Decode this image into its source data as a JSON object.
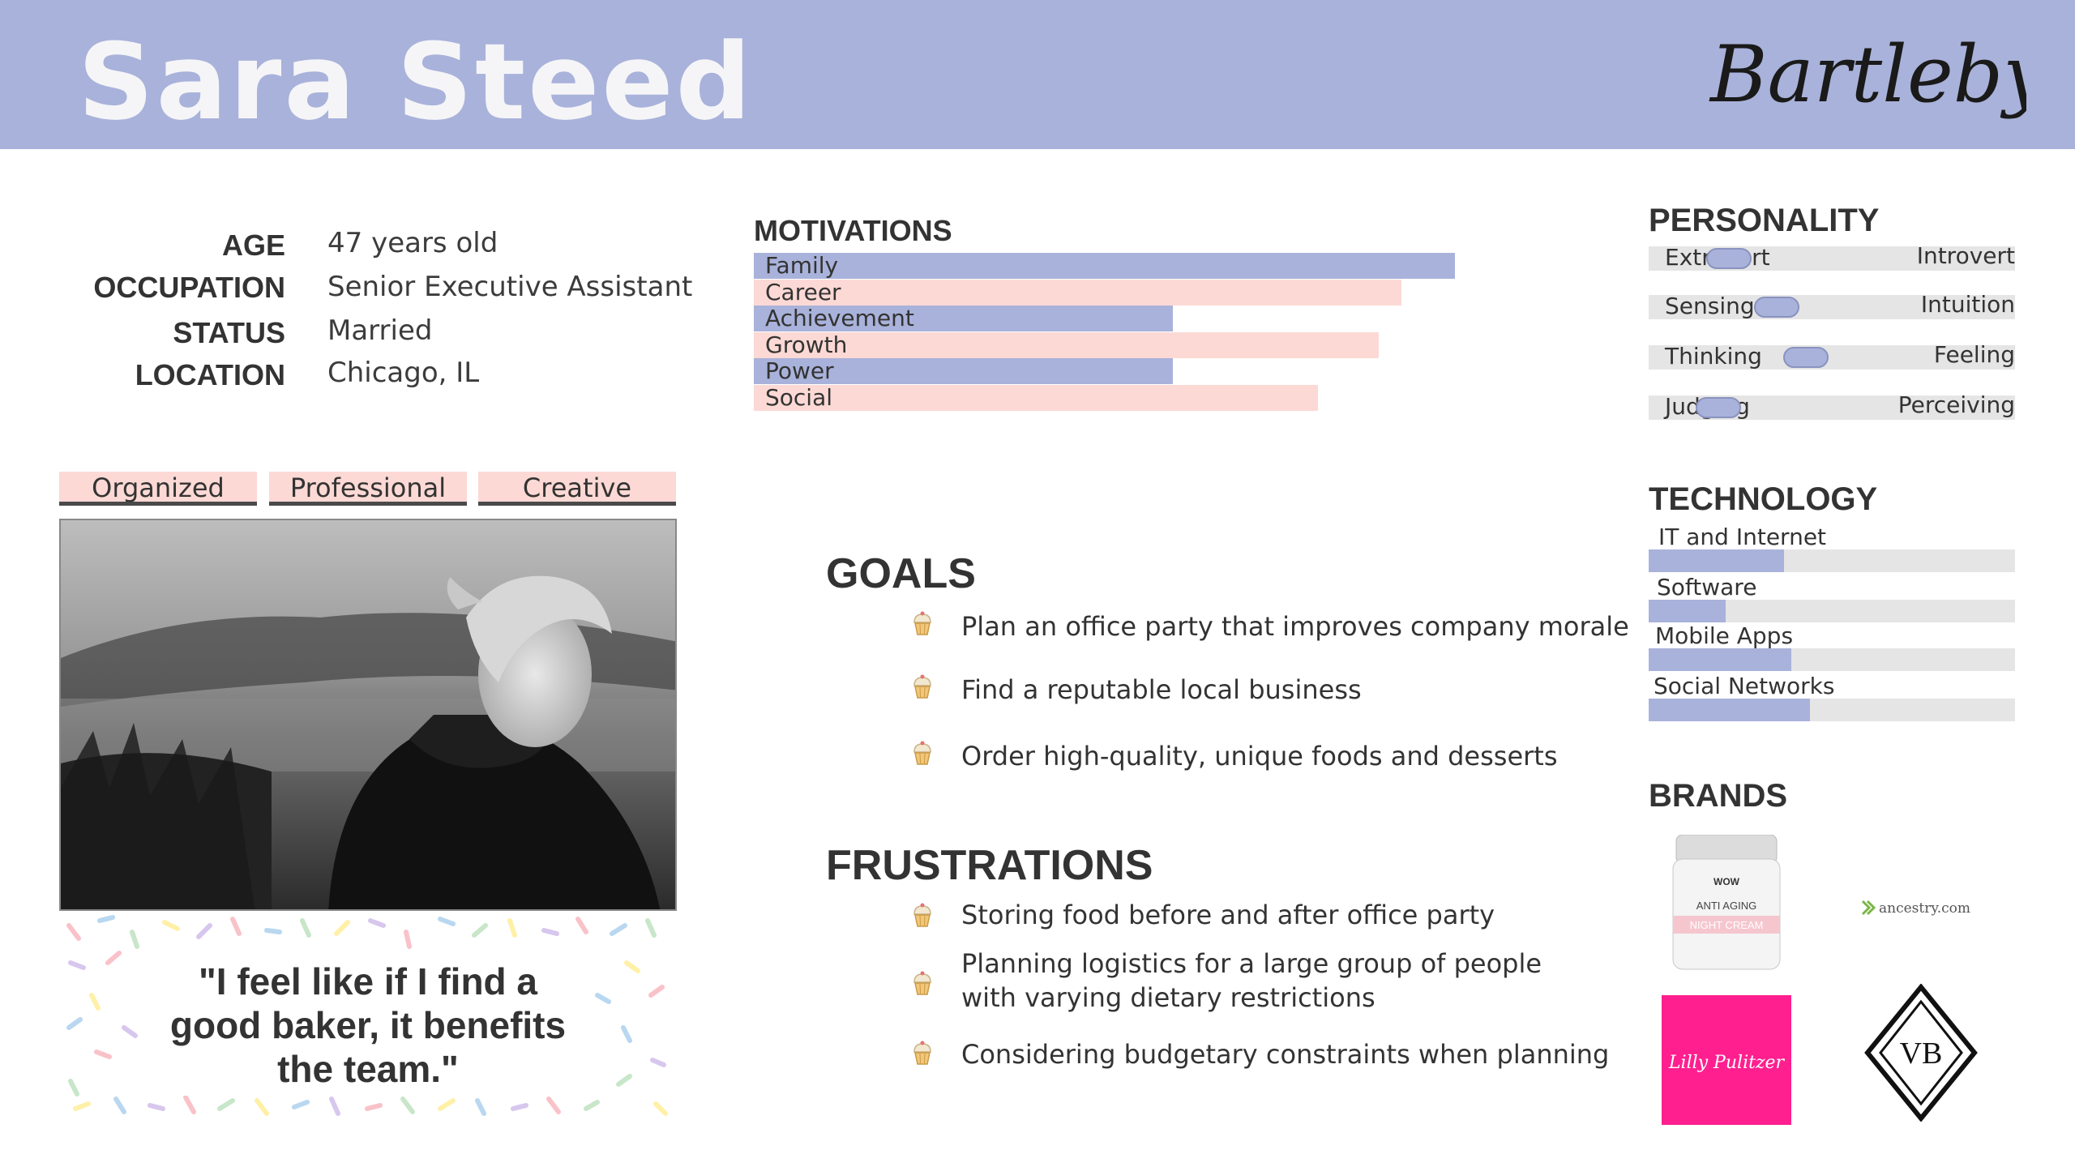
{
  "persona": {
    "name": "Sara Steed",
    "logo_text": "Bartleby's"
  },
  "demographics": [
    {
      "label": "AGE",
      "value": "47 years old"
    },
    {
      "label": "OCCUPATION",
      "value": "Senior Executive Assistant"
    },
    {
      "label": "STATUS",
      "value": "Married"
    },
    {
      "label": "LOCATION",
      "value": "Chicago, IL"
    }
  ],
  "traits": [
    "Organized",
    "Professional",
    "Creative"
  ],
  "quote": "\"I feel like if I find a good baker, it benefits the team.\"",
  "motivations": {
    "title": "MOTIVATIONS",
    "items": [
      {
        "label": "Family",
        "value": 0.92
      },
      {
        "label": "Career",
        "value": 0.85
      },
      {
        "label": "Achievement",
        "value": 0.55
      },
      {
        "label": "Growth",
        "value": 0.82
      },
      {
        "label": "Power",
        "value": 0.55
      },
      {
        "label": "Social",
        "value": 0.74
      }
    ]
  },
  "goals": {
    "title": "GOALS",
    "items": [
      "Plan an office party that improves company morale",
      "Find a reputable local business",
      "Order high-quality, unique foods and desserts"
    ]
  },
  "frustrations": {
    "title": "FRUSTRATIONS",
    "items": [
      "Storing food before and after office party",
      "Planning logistics for a large group of people with varying dietary restrictions",
      "Considering budgetary constraints when planning"
    ]
  },
  "personality": {
    "title": "PERSONALITY",
    "items": [
      {
        "left": "Extrovert",
        "right": "Introvert",
        "position": 0.22
      },
      {
        "left": "Sensing",
        "right": "Intuition",
        "position": 0.35
      },
      {
        "left": "Thinking",
        "right": "Feeling",
        "position": 0.43
      },
      {
        "left": "Judging",
        "right": "Perceiving",
        "position": 0.19
      }
    ]
  },
  "technology": {
    "title": "TECHNOLOGY",
    "items": [
      {
        "label": "IT and Internet",
        "value": 0.37
      },
      {
        "label": "Software",
        "value": 0.21
      },
      {
        "label": "Mobile Apps",
        "value": 0.39
      },
      {
        "label": "Social Networks",
        "value": 0.44
      }
    ]
  },
  "brands": {
    "title": "BRANDS",
    "items": [
      {
        "name": "wow-night-cream",
        "lines": [
          "WOW",
          "ANTI AGING",
          "NIGHT CREAM"
        ]
      },
      {
        "name": "ancestry",
        "lines": [
          "ancestry.com"
        ]
      },
      {
        "name": "lilly-pulitzer",
        "lines": [
          "Lilly Pulitzer"
        ]
      },
      {
        "name": "vb",
        "lines": [
          "VB"
        ]
      }
    ]
  },
  "colors": {
    "accent_blue": "#a9b2da",
    "accent_pink": "#fcd9d5",
    "track_gray": "#e5e5e5",
    "text_dark": "#333333",
    "lilly_pink": "#ff1f8f"
  }
}
